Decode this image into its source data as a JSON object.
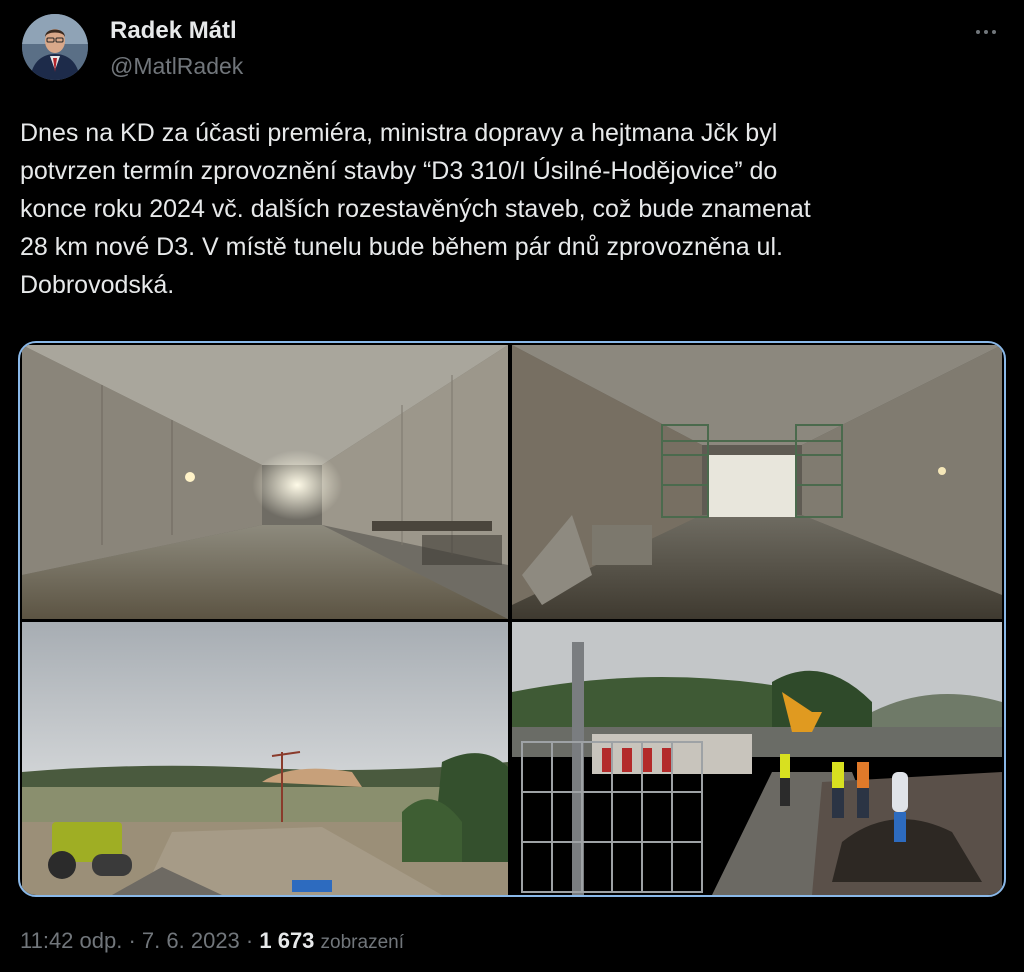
{
  "author": {
    "display_name": "Radek Mátl",
    "handle": "@MatlRadek"
  },
  "more_icon": "more-horizontal-icon",
  "tweet": {
    "lines": [
      "Dnes na KD za účasti premiéra, ministra dopravy a hejtmana Jčk byl",
      "potvrzen termín zprovoznění stavby “D3 310/I Úsilné-Hodějovice” do",
      "konce roku 2024 vč. dalších rozestavěných staveb, což bude znamenat",
      "28 km nové D3. V místě tunelu bude během pár dnů zprovozněna ul.",
      "Dobrovodská."
    ]
  },
  "media": {
    "count": 4,
    "border_color": "#8ab8e8"
  },
  "meta": {
    "time": "11:42 odp.",
    "separator": " · ",
    "date": "7. 6. 2023",
    "separator2": " · ",
    "views_count": "1 673",
    "views_label": "zobrazení"
  },
  "colors": {
    "background": "#000000",
    "text": "#e7e9ea",
    "secondary": "#71767b"
  }
}
